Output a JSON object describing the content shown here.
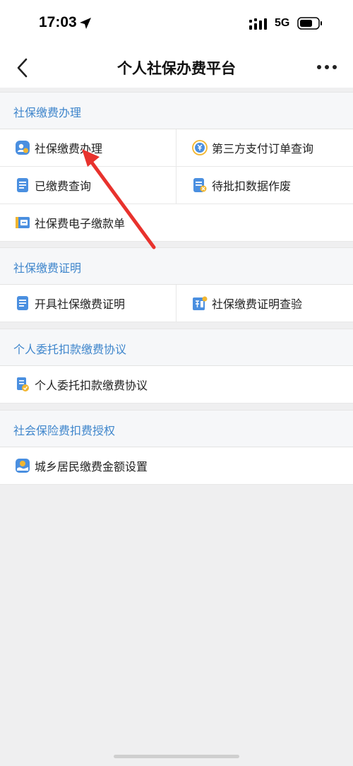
{
  "status_bar": {
    "time": "17:03",
    "network": "5G",
    "icons": [
      "location-arrow-icon",
      "signal-icon",
      "battery-icon"
    ]
  },
  "nav": {
    "title": "个人社保办费平台",
    "icons": [
      "back-chevron-icon",
      "more-dots-icon"
    ]
  },
  "sections": [
    {
      "title": "社保缴费办理",
      "items": [
        {
          "label": "社保缴费办理",
          "icon": "user-payment-icon"
        },
        {
          "label": "第三方支付订单查询",
          "icon": "yuan-circle-icon"
        },
        {
          "label": "已缴费查询",
          "icon": "document-list-icon"
        },
        {
          "label": "待批扣数据作废",
          "icon": "document-cancel-icon"
        },
        {
          "label": "社保费电子缴款单",
          "icon": "receipt-icon"
        }
      ]
    },
    {
      "title": "社保缴费证明",
      "items": [
        {
          "label": "开具社保缴费证明",
          "icon": "document-list-icon"
        },
        {
          "label": "社保缴费证明查验",
          "icon": "certificate-check-icon"
        }
      ]
    },
    {
      "title": "个人委托扣款缴费协议",
      "items": [
        {
          "label": "个人委托扣款缴费协议",
          "icon": "agreement-icon"
        }
      ]
    },
    {
      "title": "社会保险费扣费授权",
      "items": [
        {
          "label": "城乡居民缴费金额设置",
          "icon": "hand-money-icon"
        }
      ]
    }
  ],
  "annotation": {
    "icon": "red-arrow-icon",
    "color": "#e8322d"
  },
  "colors": {
    "accent": "#3f86cc",
    "background": "#efeff0",
    "arrow": "#e8322d"
  }
}
